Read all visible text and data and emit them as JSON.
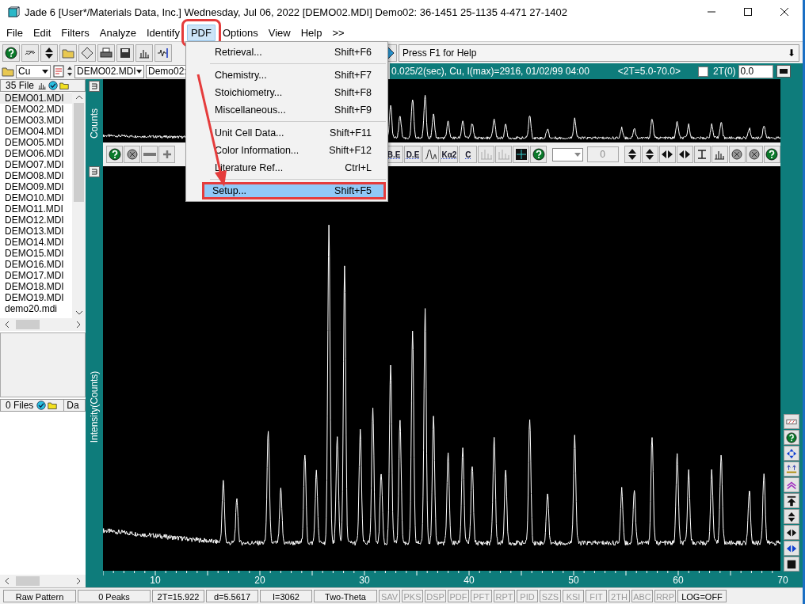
{
  "window": {
    "title": "Jade 6 [User*/Materials Data, Inc.] Wednesday, Jul 06, 2022 [DEMO02.MDI] Demo02: 36-1451 25-1135 4-471 27-1402"
  },
  "menu_bar": [
    {
      "label": "File",
      "selected": false,
      "annotated": false
    },
    {
      "label": "Edit",
      "selected": false,
      "annotated": false
    },
    {
      "label": "Filters",
      "selected": false,
      "annotated": false
    },
    {
      "label": "Analyze",
      "selected": false,
      "annotated": false
    },
    {
      "label": "Identify",
      "selected": false,
      "annotated": false
    },
    {
      "label": "PDF",
      "selected": true,
      "annotated": true
    },
    {
      "label": "Options",
      "selected": false,
      "annotated": false
    },
    {
      "label": "View",
      "selected": false,
      "annotated": false
    },
    {
      "label": "Help",
      "selected": false,
      "annotated": false
    },
    {
      "label": ">>",
      "selected": false,
      "annotated": false
    }
  ],
  "pdf_menu": [
    {
      "label": "Retrieval...",
      "shortcut": "Shift+F6",
      "highlighted": false,
      "annotated": false,
      "separator_after": true
    },
    {
      "label": "Chemistry...",
      "shortcut": "Shift+F7",
      "highlighted": false,
      "annotated": false,
      "separator_after": false
    },
    {
      "label": "Stoichiometry...",
      "shortcut": "Shift+F8",
      "highlighted": false,
      "annotated": false,
      "separator_after": false
    },
    {
      "label": "Miscellaneous...",
      "shortcut": "Shift+F9",
      "highlighted": false,
      "annotated": false,
      "separator_after": true
    },
    {
      "label": "Unit Cell Data...",
      "shortcut": "Shift+F11",
      "highlighted": false,
      "annotated": false,
      "separator_after": false
    },
    {
      "label": "Color Information...",
      "shortcut": "Shift+F12",
      "highlighted": false,
      "annotated": false,
      "separator_after": false
    },
    {
      "label": "Literature Ref...",
      "shortcut": "Ctrl+L",
      "highlighted": false,
      "annotated": false,
      "separator_after": true
    },
    {
      "label": "Setup...",
      "shortcut": "Shift+F5",
      "highlighted": true,
      "annotated": true,
      "separator_after": false
    }
  ],
  "toolbar": {
    "help_text": "Press F1 for Help",
    "arrow": "⬇"
  },
  "selectors": {
    "element": "Cu",
    "file": "DEMO02.MDI",
    "pattern": "Demo02:"
  },
  "info_bar": {
    "text": "0.025/2(sec), Cu, I(max)=2916, 01/02/99 04:00",
    "range": "<2T=5.0-70.0>",
    "offset_checked": false,
    "offset_label": "2T(0)",
    "offset_value": "0.0"
  },
  "file_panel": {
    "count": "35 File",
    "files": [
      {
        "name": "DEMO01.MDI",
        "selected": true
      },
      {
        "name": "DEMO02.MDI",
        "selected": false
      },
      {
        "name": "DEMO03.MDI",
        "selected": false
      },
      {
        "name": "DEMO04.MDI",
        "selected": false
      },
      {
        "name": "DEMO05.MDI",
        "selected": false
      },
      {
        "name": "DEMO06.MDI",
        "selected": false
      },
      {
        "name": "DEMO07.MDI",
        "selected": false
      },
      {
        "name": "DEMO08.MDI",
        "selected": false
      },
      {
        "name": "DEMO09.MDI",
        "selected": false
      },
      {
        "name": "DEMO10.MDI",
        "selected": false
      },
      {
        "name": "DEMO11.MDI",
        "selected": false
      },
      {
        "name": "DEMO12.MDI",
        "selected": false
      },
      {
        "name": "DEMO13.MDI",
        "selected": false
      },
      {
        "name": "DEMO14.MDI",
        "selected": false
      },
      {
        "name": "DEMO15.MDI",
        "selected": false
      },
      {
        "name": "DEMO16.MDI",
        "selected": false
      },
      {
        "name": "DEMO17.MDI",
        "selected": false
      },
      {
        "name": "DEMO18.MDI",
        "selected": false
      },
      {
        "name": "DEMO19.MDI",
        "selected": false
      },
      {
        "name": "demo20.mdi",
        "selected": false
      }
    ],
    "lower_count": "0 Files",
    "lower_column": "Da"
  },
  "chart": {
    "top_label": "Counts",
    "ylabel": "Intensity(Counts)",
    "xticks": [
      "10",
      "20",
      "30",
      "40",
      "50",
      "60",
      "70"
    ]
  },
  "analysis_toolbar": {
    "buttons": [
      "B.E",
      "D.E",
      "Kα2",
      "C"
    ],
    "value": "0"
  },
  "status_bar": [
    {
      "label": "Raw Pattern",
      "disabled": false
    },
    {
      "label": "0 Peaks",
      "disabled": false
    },
    {
      "label": "2T=15.922",
      "disabled": false
    },
    {
      "label": "d=5.5617",
      "disabled": false
    },
    {
      "label": "I=3062",
      "disabled": false
    },
    {
      "label": "Two-Theta",
      "disabled": false
    },
    {
      "label": "SAV",
      "disabled": true
    },
    {
      "label": "PKS",
      "disabled": true
    },
    {
      "label": "DSP",
      "disabled": true
    },
    {
      "label": "PDF",
      "disabled": true
    },
    {
      "label": "PFT",
      "disabled": true
    },
    {
      "label": "RPT",
      "disabled": true
    },
    {
      "label": "PID",
      "disabled": true
    },
    {
      "label": "SZS",
      "disabled": true
    },
    {
      "label": "KSI",
      "disabled": true
    },
    {
      "label": "FIT",
      "disabled": true
    },
    {
      "label": "2TH",
      "disabled": true
    },
    {
      "label": "ABC",
      "disabled": true
    },
    {
      "label": "RRP",
      "disabled": true
    },
    {
      "label": "LOG=OFF",
      "disabled": false
    }
  ]
}
